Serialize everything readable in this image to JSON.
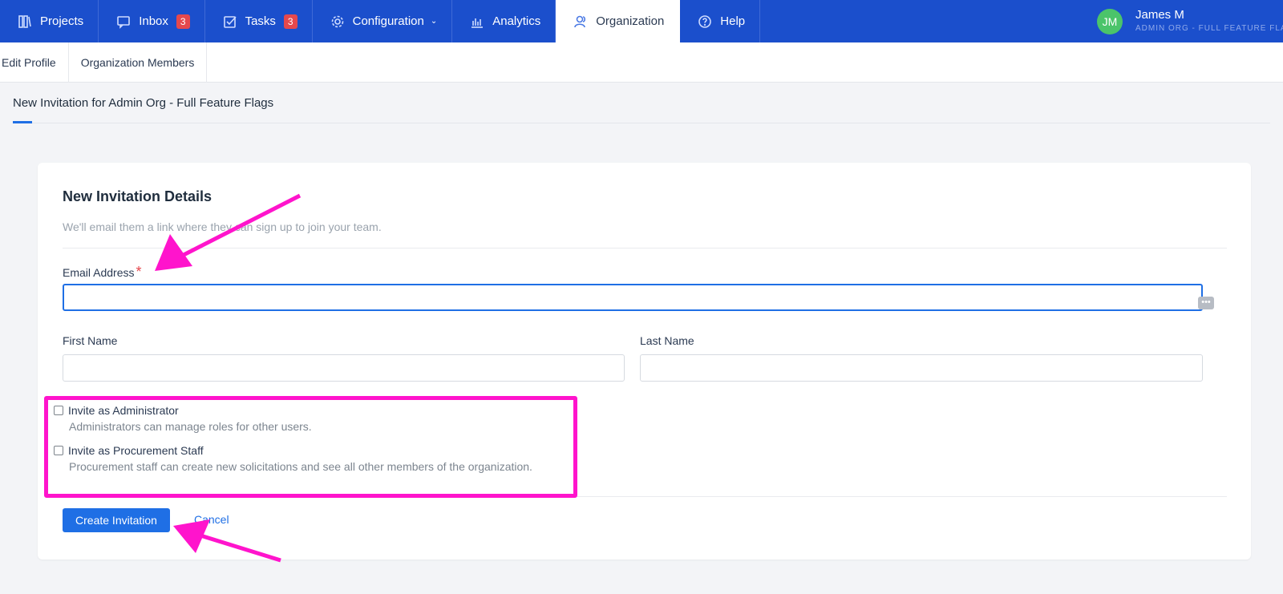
{
  "nav": {
    "items": [
      {
        "label": "Projects",
        "icon": "projects-icon"
      },
      {
        "label": "Inbox",
        "icon": "inbox-icon",
        "badge": "3"
      },
      {
        "label": "Tasks",
        "icon": "tasks-icon",
        "badge": "3"
      },
      {
        "label": "Configuration",
        "icon": "gear-icon"
      },
      {
        "label": "Analytics",
        "icon": "chart-icon"
      },
      {
        "label": "Organization",
        "icon": "users-icon"
      },
      {
        "label": "Help",
        "icon": "help-icon"
      }
    ],
    "active": "Organization"
  },
  "user": {
    "initials": "JM",
    "name": "James M",
    "org": "ADMIN ORG - FULL FEATURE FLA",
    "avatar_color": "#4bc46a"
  },
  "subnav": {
    "items": [
      "Edit Profile",
      "Organization Members"
    ]
  },
  "page": {
    "tab_title": "New Invitation for Admin Org - Full Feature Flags"
  },
  "form": {
    "title": "New Invitation Details",
    "subtitle": "We'll email them a link where they can sign up to join your team.",
    "email_label": "Email Address",
    "required_mark": "*",
    "email_value": "",
    "first_name_label": "First Name",
    "first_name_value": "",
    "last_name_label": "Last Name",
    "last_name_value": "",
    "admin_check_label": "Invite as Administrator",
    "admin_check_help": "Administrators can manage roles for other users.",
    "procurement_check_label": "Invite as Procurement Staff",
    "procurement_check_help": "Procurement staff can create new solicitations and see all other members of the organization.",
    "submit_label": "Create Invitation",
    "cancel_label": "Cancel",
    "password_manager_icon": "•••"
  },
  "colors": {
    "nav_bg": "#1b4fcc",
    "primary": "#1f6fe5",
    "annotation": "#ff14cc",
    "required": "#e5484d"
  }
}
